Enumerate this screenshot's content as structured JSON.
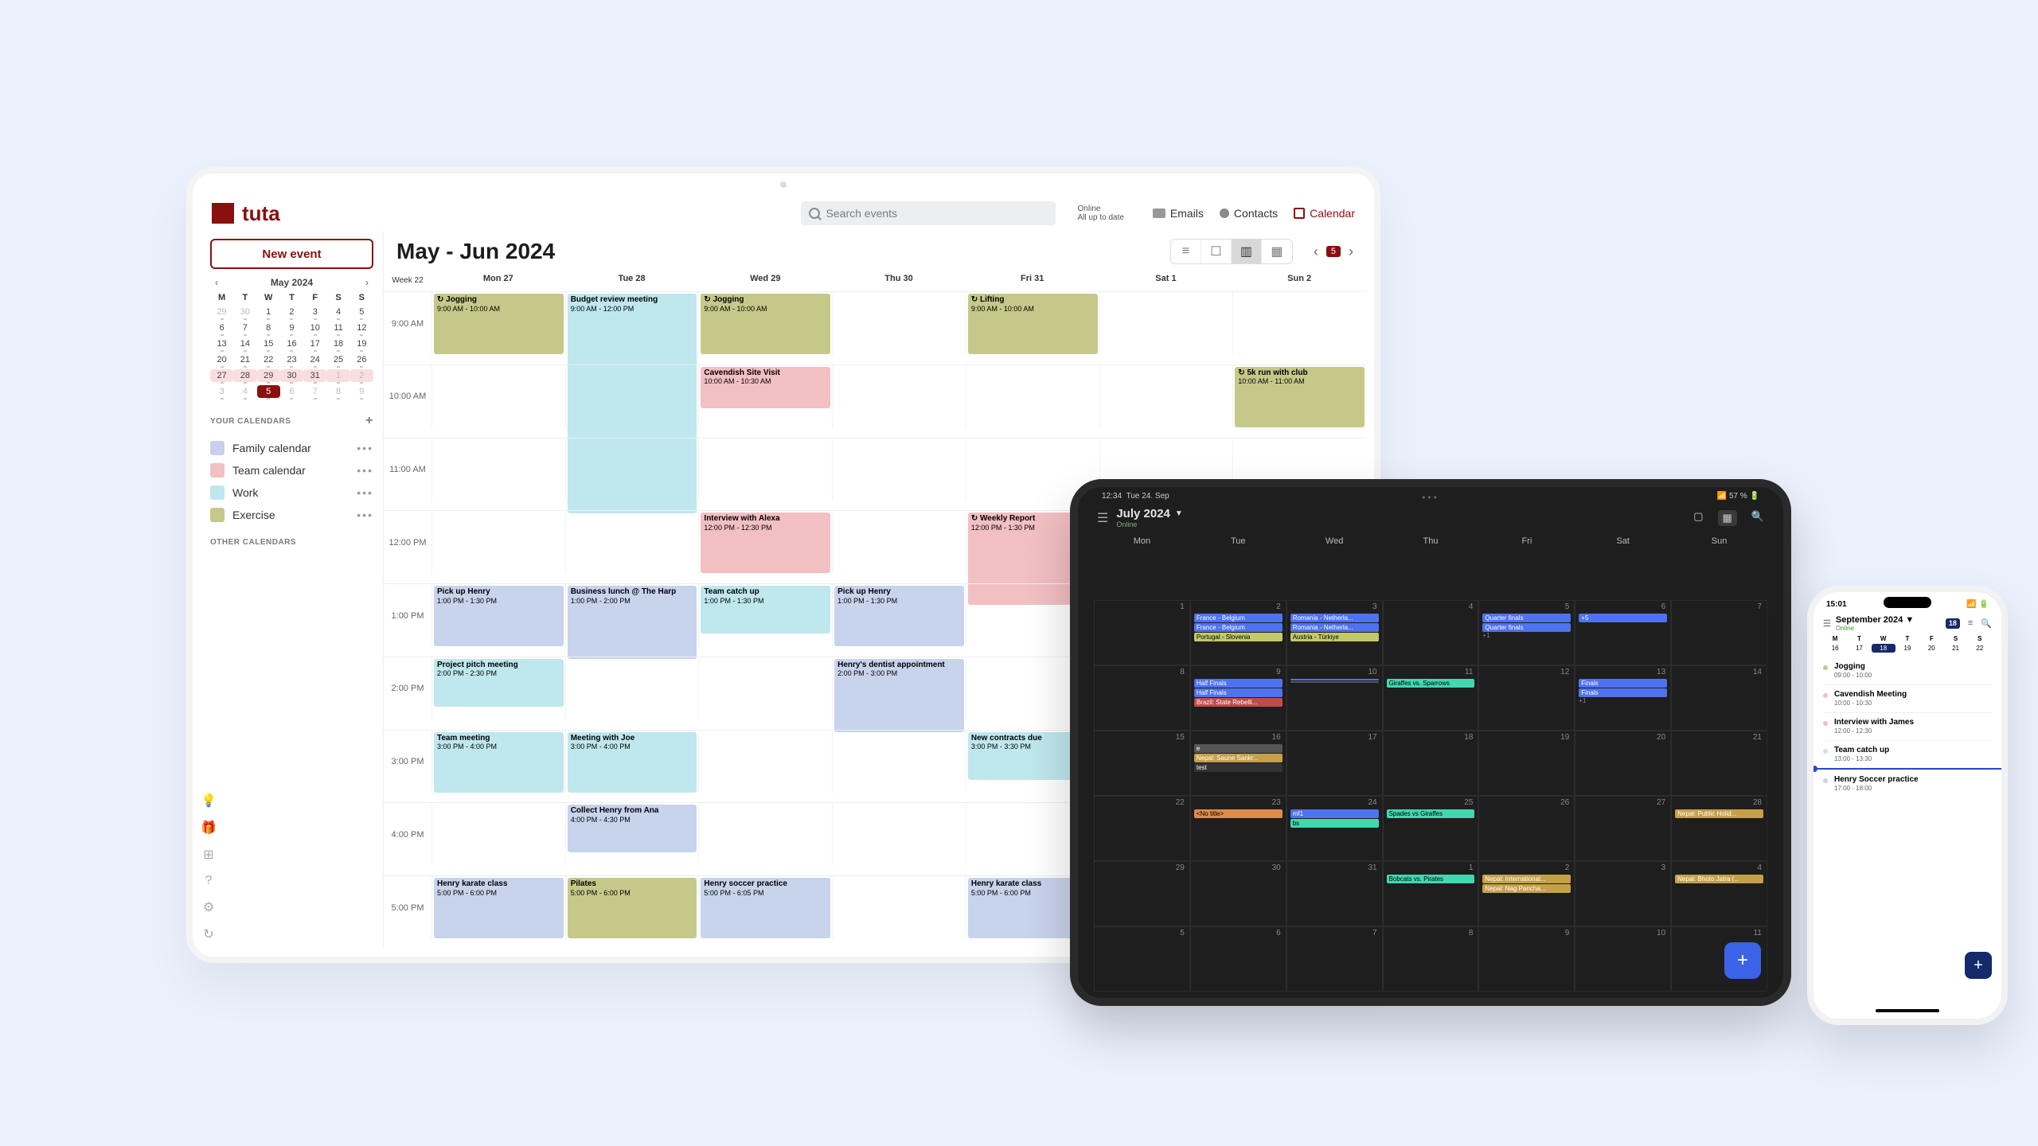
{
  "app": {
    "brand": "tuta"
  },
  "topbar": {
    "search_placeholder": "Search events",
    "status_line1": "Online",
    "status_line2": "All up to date",
    "nav": {
      "emails": "Emails",
      "contacts": "Contacts",
      "calendar": "Calendar"
    }
  },
  "sidebar": {
    "new_event": "New event",
    "mini_title": "May 2024",
    "dow": [
      "M",
      "T",
      "W",
      "T",
      "F",
      "S",
      "S"
    ],
    "grid": [
      {
        "n": "29",
        "muted": true
      },
      {
        "n": "30",
        "muted": true
      },
      {
        "n": "1"
      },
      {
        "n": "2"
      },
      {
        "n": "3"
      },
      {
        "n": "4"
      },
      {
        "n": "5"
      },
      {
        "n": "6"
      },
      {
        "n": "7"
      },
      {
        "n": "8"
      },
      {
        "n": "9"
      },
      {
        "n": "10"
      },
      {
        "n": "11"
      },
      {
        "n": "12"
      },
      {
        "n": "13"
      },
      {
        "n": "14"
      },
      {
        "n": "15"
      },
      {
        "n": "16"
      },
      {
        "n": "17"
      },
      {
        "n": "18"
      },
      {
        "n": "19"
      },
      {
        "n": "20"
      },
      {
        "n": "21"
      },
      {
        "n": "22"
      },
      {
        "n": "23"
      },
      {
        "n": "24"
      },
      {
        "n": "25"
      },
      {
        "n": "26"
      },
      {
        "n": "27",
        "hl": true
      },
      {
        "n": "28",
        "hl": true
      },
      {
        "n": "29",
        "hl": true
      },
      {
        "n": "30",
        "hl": true
      },
      {
        "n": "31",
        "hl": true
      },
      {
        "n": "1",
        "hl": true,
        "muted": true
      },
      {
        "n": "2",
        "hl": true,
        "muted": true
      },
      {
        "n": "3",
        "muted": true
      },
      {
        "n": "4",
        "muted": true
      },
      {
        "n": "5",
        "muted": true,
        "today": true
      },
      {
        "n": "6",
        "muted": true
      },
      {
        "n": "7",
        "muted": true
      },
      {
        "n": "8",
        "muted": true
      },
      {
        "n": "9",
        "muted": true
      }
    ],
    "your_cal": "YOUR CALENDARS",
    "other_cal": "OTHER CALENDARS",
    "cals": [
      {
        "label": "Family calendar",
        "color": "#c8d0ee"
      },
      {
        "label": "Team calendar",
        "color": "#f2bfc3"
      },
      {
        "label": "Work",
        "color": "#bfe7ee"
      },
      {
        "label": "Exercise",
        "color": "#c6c88a"
      }
    ]
  },
  "main": {
    "title": "May - Jun 2024",
    "week_label": "Week 22",
    "pager_badge": "5",
    "days": [
      {
        "label": "Mon",
        "num": "27"
      },
      {
        "label": "Tue",
        "num": "28"
      },
      {
        "label": "Wed",
        "num": "29"
      },
      {
        "label": "Thu",
        "num": "30"
      },
      {
        "label": "Fri",
        "num": "31"
      },
      {
        "label": "Sat",
        "num": "1"
      },
      {
        "label": "Sun",
        "num": "2"
      }
    ],
    "hours": [
      "9:00 AM",
      "10:00 AM",
      "11:00 AM",
      "12:00 PM",
      "1:00 PM",
      "2:00 PM",
      "3:00 PM",
      "4:00 PM",
      "5:00 PM"
    ],
    "events": [
      {
        "col": 0,
        "row": 0,
        "span": 1,
        "title": "Jogging",
        "time": "9:00 AM - 10:00 AM",
        "color": "#c6c88a",
        "repeat": true
      },
      {
        "col": 1,
        "row": 0,
        "span": 3.5,
        "title": "Budget review meeting",
        "time": "9:00 AM - 12:00 PM",
        "color": "#bfe7ee"
      },
      {
        "col": 2,
        "row": 0,
        "span": 1,
        "title": "Jogging",
        "time": "9:00 AM - 10:00 AM",
        "color": "#c6c88a",
        "repeat": true
      },
      {
        "col": 4,
        "row": 0,
        "span": 1,
        "title": "Lifting",
        "time": "9:00 AM - 10:00 AM",
        "color": "#c6c88a",
        "repeat": true
      },
      {
        "col": 6,
        "row": 1,
        "span": 1,
        "title": "5k run with club",
        "time": "10:00 AM - 11:00 AM",
        "color": "#c6c88a",
        "repeat": true
      },
      {
        "col": 2,
        "row": 1,
        "span": 0.7,
        "title": "Cavendish Site Visit",
        "time": "10:00 AM - 10:30 AM",
        "color": "#f2bfc3"
      },
      {
        "col": 2,
        "row": 3,
        "span": 1,
        "title": "Interview with Alexa",
        "time": "12:00 PM - 12:30 PM",
        "color": "#f2bfc3"
      },
      {
        "col": 4,
        "row": 3,
        "span": 1.5,
        "title": "Weekly Report",
        "time": "12:00 PM - 1:30 PM",
        "color": "#f2bfc3",
        "repeat": true
      },
      {
        "col": 0,
        "row": 4,
        "span": 1,
        "title": "Pick up Henry",
        "time": "1:00 PM - 1:30 PM",
        "color": "#c8d3ec"
      },
      {
        "col": 1,
        "row": 4,
        "span": 1.2,
        "title": "Business lunch @ The Harp",
        "time": "1:00 PM - 2:00 PM",
        "color": "#c8d3ec"
      },
      {
        "col": 2,
        "row": 4,
        "span": 0.8,
        "title": "Team catch up",
        "time": "1:00 PM - 1:30 PM",
        "color": "#bfe7ee"
      },
      {
        "col": 3,
        "row": 4,
        "span": 1,
        "title": "Pick up Henry",
        "time": "1:00 PM - 1:30 PM",
        "color": "#c8d3ec"
      },
      {
        "col": 0,
        "row": 5,
        "span": 0.8,
        "title": "Project pitch meeting",
        "time": "2:00 PM - 2:30 PM",
        "color": "#bfe7ee"
      },
      {
        "col": 3,
        "row": 5,
        "span": 1.2,
        "title": "Henry's dentist appointment",
        "time": "2:00 PM - 3:00 PM",
        "color": "#c8d3ec"
      },
      {
        "col": 0,
        "row": 6,
        "span": 1,
        "title": "Team meeting",
        "time": "3:00 PM - 4:00 PM",
        "color": "#bfe7ee"
      },
      {
        "col": 1,
        "row": 6,
        "span": 1,
        "title": "Meeting with Joe",
        "time": "3:00 PM - 4:00 PM",
        "color": "#bfe7ee"
      },
      {
        "col": 4,
        "row": 6,
        "span": 0.8,
        "title": "New contracts due",
        "time": "3:00 PM - 3:30 PM",
        "color": "#bfe7ee"
      },
      {
        "col": 1,
        "row": 7,
        "span": 0.8,
        "title": "Collect Henry from Ana",
        "time": "4:00 PM - 4:30 PM",
        "color": "#c8d3ec"
      },
      {
        "col": 0,
        "row": 8,
        "span": 1,
        "title": "Henry karate class",
        "time": "5:00 PM - 6:00 PM",
        "color": "#c8d3ec"
      },
      {
        "col": 1,
        "row": 8,
        "span": 1,
        "title": "Pilates",
        "time": "5:00 PM - 6:00 PM",
        "color": "#c6c88a"
      },
      {
        "col": 2,
        "row": 8,
        "span": 1,
        "title": "Henry soccer practice",
        "time": "5:00 PM - 6:05 PM",
        "color": "#c8d3ec"
      },
      {
        "col": 4,
        "row": 8,
        "span": 1,
        "title": "Henry karate class",
        "time": "5:00 PM - 6:00 PM",
        "color": "#c8d3ec"
      }
    ]
  },
  "tablet": {
    "time": "12:34",
    "date": "Tue 24. Sep",
    "title": "July 2024",
    "sub": "Online",
    "battery": "57 %",
    "dow": [
      "Mon",
      "Tue",
      "Wed",
      "Thu",
      "Fri",
      "Sat",
      "Sun"
    ],
    "cells": [
      {
        "n": "1"
      },
      {
        "n": "2",
        "chips": [
          {
            "t": "France - Belgium",
            "c": "#4f72f0",
            "dk": true
          },
          {
            "t": "France - Belgium",
            "c": "#4f72f0",
            "dk": true
          },
          {
            "t": "Portugal - Slovenia",
            "c": "#c3c969"
          }
        ]
      },
      {
        "n": "3",
        "chips": [
          {
            "t": "Romania - Netherla...",
            "c": "#4f72f0",
            "dk": true
          },
          {
            "t": "Romania - Netherla...",
            "c": "#4f72f0",
            "dk": true
          },
          {
            "t": "Austria - Türkiye",
            "c": "#c3c969"
          }
        ]
      },
      {
        "n": "4"
      },
      {
        "n": "5",
        "chips": [
          {
            "t": "Quarter finals",
            "c": "#4f72f0",
            "dk": true
          },
          {
            "t": "Quarter finals",
            "c": "#4f72f0",
            "dk": true
          }
        ],
        "extra": "+1"
      },
      {
        "n": "6",
        "chips": [
          {
            "t": "+5",
            "c": "#4f72f0",
            "dk": true
          }
        ]
      },
      {
        "n": "7"
      },
      {
        "n": "8"
      },
      {
        "n": "9",
        "chips": [
          {
            "t": "Half Finals",
            "c": "#4f72f0",
            "dk": true
          },
          {
            "t": "Half Finals",
            "c": "#4f72f0",
            "dk": true
          },
          {
            "t": "Brazil: State Rebelli...",
            "c": "#c54949",
            "dk": true
          }
        ]
      },
      {
        "n": "10",
        "chips": [
          {
            "t": "",
            "c": "#4f72f0",
            "dk": true
          },
          {
            "t": "",
            "c": "#555",
            "dk": true
          }
        ]
      },
      {
        "n": "11",
        "chips": [
          {
            "t": "Giraffes vs. Sparrows",
            "c": "#41d7b0"
          }
        ]
      },
      {
        "n": "12"
      },
      {
        "n": "13",
        "chips": [
          {
            "t": "Finals",
            "c": "#4f72f0",
            "dk": true
          },
          {
            "t": "Finals",
            "c": "#4f72f0",
            "dk": true
          }
        ],
        "extra": "+1"
      },
      {
        "n": "14"
      },
      {
        "n": "15"
      },
      {
        "n": "16",
        "chips": [
          {
            "t": "e",
            "c": "#555",
            "dk": true
          },
          {
            "t": "Nepal: Saune Sankr...",
            "c": "#c5a049",
            "dk": true
          },
          {
            "t": "test",
            "c": "#333",
            "dk": true
          }
        ]
      },
      {
        "n": "17"
      },
      {
        "n": "18"
      },
      {
        "n": "19"
      },
      {
        "n": "20"
      },
      {
        "n": "21"
      },
      {
        "n": "22"
      },
      {
        "n": "23",
        "chips": [
          {
            "t": "<No title>",
            "c": "#e08a4a"
          }
        ]
      },
      {
        "n": "24",
        "chips": [
          {
            "t": "mf1",
            "c": "#4f72f0",
            "dk": true
          },
          {
            "t": "bs",
            "c": "#41d7b0"
          }
        ]
      },
      {
        "n": "25",
        "chips": [
          {
            "t": "Spades vs Giraffes",
            "c": "#41d7b0"
          }
        ]
      },
      {
        "n": "26"
      },
      {
        "n": "27"
      },
      {
        "n": "28",
        "chips": [
          {
            "t": "Nepal: Public Holid...",
            "c": "#c5a049",
            "dk": true
          }
        ]
      },
      {
        "n": "29"
      },
      {
        "n": "30"
      },
      {
        "n": "31"
      },
      {
        "n": "1",
        "muted": true,
        "chips": [
          {
            "t": "Bobcats vs. Pirates",
            "c": "#41d7b0"
          }
        ]
      },
      {
        "n": "2",
        "muted": true,
        "chips": [
          {
            "t": "Nepal: International...",
            "c": "#c5a049",
            "dk": true
          },
          {
            "t": "Nepal: Nag Pancha...",
            "c": "#c5a049",
            "dk": true
          }
        ]
      },
      {
        "n": "3",
        "muted": true
      },
      {
        "n": "4",
        "muted": true,
        "chips": [
          {
            "t": "Nepal: Bhoto Jatra (...",
            "c": "#c5a049",
            "dk": true
          }
        ]
      },
      {
        "n": "5",
        "muted": true
      },
      {
        "n": "6",
        "muted": true
      },
      {
        "n": "7",
        "muted": true
      },
      {
        "n": "8",
        "muted": true
      },
      {
        "n": "9",
        "muted": true
      },
      {
        "n": "10",
        "muted": true
      },
      {
        "n": "11",
        "muted": true
      }
    ]
  },
  "phone": {
    "time": "15:01",
    "title": "September 2024",
    "sub": "Online",
    "dow": [
      "M",
      "T",
      "W",
      "T",
      "F",
      "S",
      "S"
    ],
    "row": [
      {
        "n": "16"
      },
      {
        "n": "17"
      },
      {
        "n": "18",
        "today": true
      },
      {
        "n": "19"
      },
      {
        "n": "20"
      },
      {
        "n": "21"
      },
      {
        "n": "22"
      }
    ],
    "agenda": [
      {
        "title": "Jogging",
        "time": "09:00 - 10:00",
        "color": "#c6c88a"
      },
      {
        "title": "Cavendish Meeting",
        "time": "10:00 - 10:30",
        "color": "#f2bfc3"
      },
      {
        "title": "Interview with James",
        "time": "12:00 - 12:30",
        "color": "#f2bfc3"
      },
      {
        "title": "Team catch up",
        "time": "13:00 - 13:30",
        "color": "#bfe7ee"
      },
      {
        "title": "Henry Soccer practice",
        "time": "17:00 - 18:00",
        "color": "#c8d3ec"
      }
    ]
  }
}
